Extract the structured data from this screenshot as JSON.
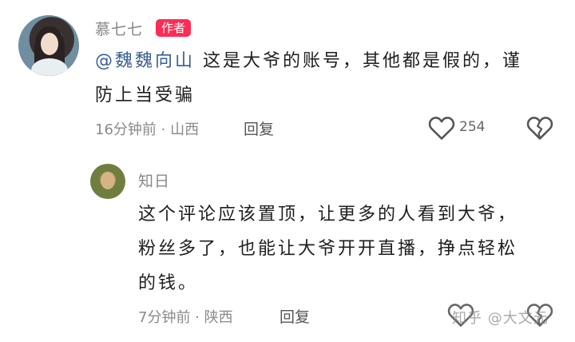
{
  "comment1": {
    "username": "慕七七",
    "badge": "作者",
    "mention": "@魏魏向山",
    "text_line1": " 这是大爷的账号，其他都是假的，谨",
    "text_line2": "防上当受骗",
    "time_location": "16分钟前 · 山西",
    "reply_label": "回复",
    "like_count": "254"
  },
  "comment2": {
    "username": "知日",
    "text_line1": "这个评论应该置顶，让更多的人看到大爷，",
    "text_line2": "粉丝多了，也能让大爷开开直播，挣点轻松",
    "text_line3": "的钱。",
    "time_location": "7分钟前 · 陕西",
    "reply_label": "回复"
  },
  "watermark": "知乎 @大文元",
  "icons": {
    "like": "heart-outline-icon",
    "dislike": "broken-heart-icon"
  }
}
